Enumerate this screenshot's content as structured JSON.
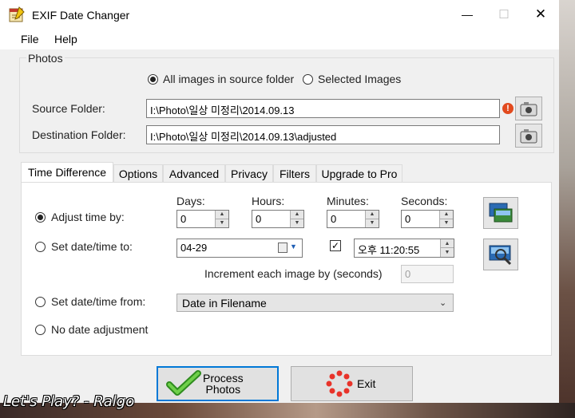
{
  "window": {
    "title": "EXIF Date Changer",
    "minimize": "—",
    "maximize": "☐",
    "close": "✕"
  },
  "menu": {
    "file": "File",
    "help": "Help"
  },
  "photos": {
    "group_label": "Photos",
    "radio_all": "All images in source folder",
    "radio_selected": "Selected Images",
    "source_label": "Source Folder:",
    "source_value": "I:\\Photo\\일상 미정리\\2014.09.13",
    "dest_label": "Destination Folder:",
    "dest_value": "I:\\Photo\\일상 미정리\\2014.09.13\\adjusted",
    "warning_glyph": "!"
  },
  "tabs": [
    "Time Difference",
    "Options",
    "Advanced",
    "Privacy",
    "Filters",
    "Upgrade to Pro"
  ],
  "time": {
    "days_label": "Days:",
    "hours_label": "Hours:",
    "minutes_label": "Minutes:",
    "seconds_label": "Seconds:",
    "days": "0",
    "hours": "0",
    "minutes": "0",
    "seconds": "0",
    "adjust_by": "Adjust time by:",
    "set_to": "Set date/time to:",
    "date_value": "04-29",
    "time_value": "오후 11:20:55",
    "increment_label": "Increment each image by (seconds)",
    "increment_value": "0",
    "set_from": "Set date/time from:",
    "from_value": "Date in Filename",
    "no_adjust": "No date adjustment"
  },
  "buttons": {
    "process": "Process\nPhotos",
    "process_line1": "Process",
    "process_line2": "Photos",
    "exit": "Exit"
  },
  "watermark": "Let's Play? - Ralgo",
  "colors": {
    "accent": "#0078d7",
    "check_green": "#3aa02a",
    "exit_red": "#e8332a",
    "warning": "#e24a1e"
  }
}
